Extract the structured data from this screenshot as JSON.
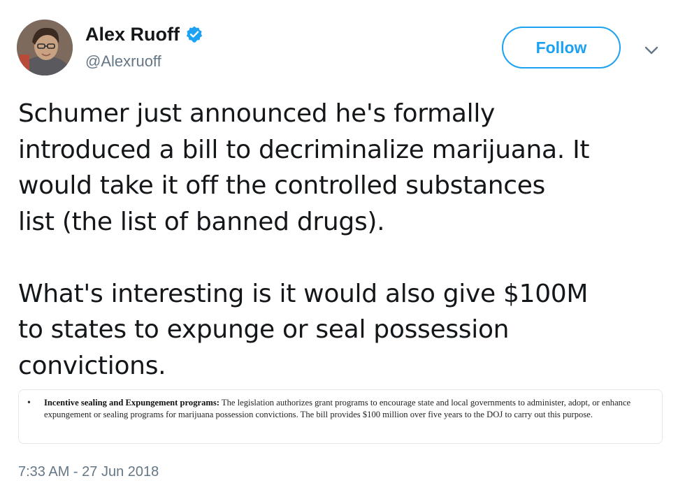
{
  "author": {
    "display_name": "Alex Ruoff",
    "handle": "@Alexruoff",
    "verified": true
  },
  "actions": {
    "follow_label": "Follow"
  },
  "tweet": {
    "paragraph_1": "Schumer just announced he's formally\nintroduced a bill to decriminalize marijuana. It\nwould take it off the controlled substances\nlist (the list of banned drugs).",
    "paragraph_2": "What's interesting is it would also give $100M\nto states to expunge or seal possession\nconvictions.",
    "timestamp": "7:33 AM - 27 Jun 2018"
  },
  "media": {
    "bullet": "•",
    "heading": "Incentive sealing and Expungement programs:",
    "body": " The legislation authorizes grant programs to encourage state and local governments to administer, adopt, or enhance expungement or sealing programs for marijuana possession convictions. The bill provides $100 million over five years to the DOJ to carry out this purpose."
  },
  "colors": {
    "brand_blue": "#1da1f2",
    "secondary_text": "#657786",
    "primary_text": "#14171a"
  },
  "icons": {
    "verified": "verified-badge-icon",
    "caret": "chevron-down-icon"
  }
}
